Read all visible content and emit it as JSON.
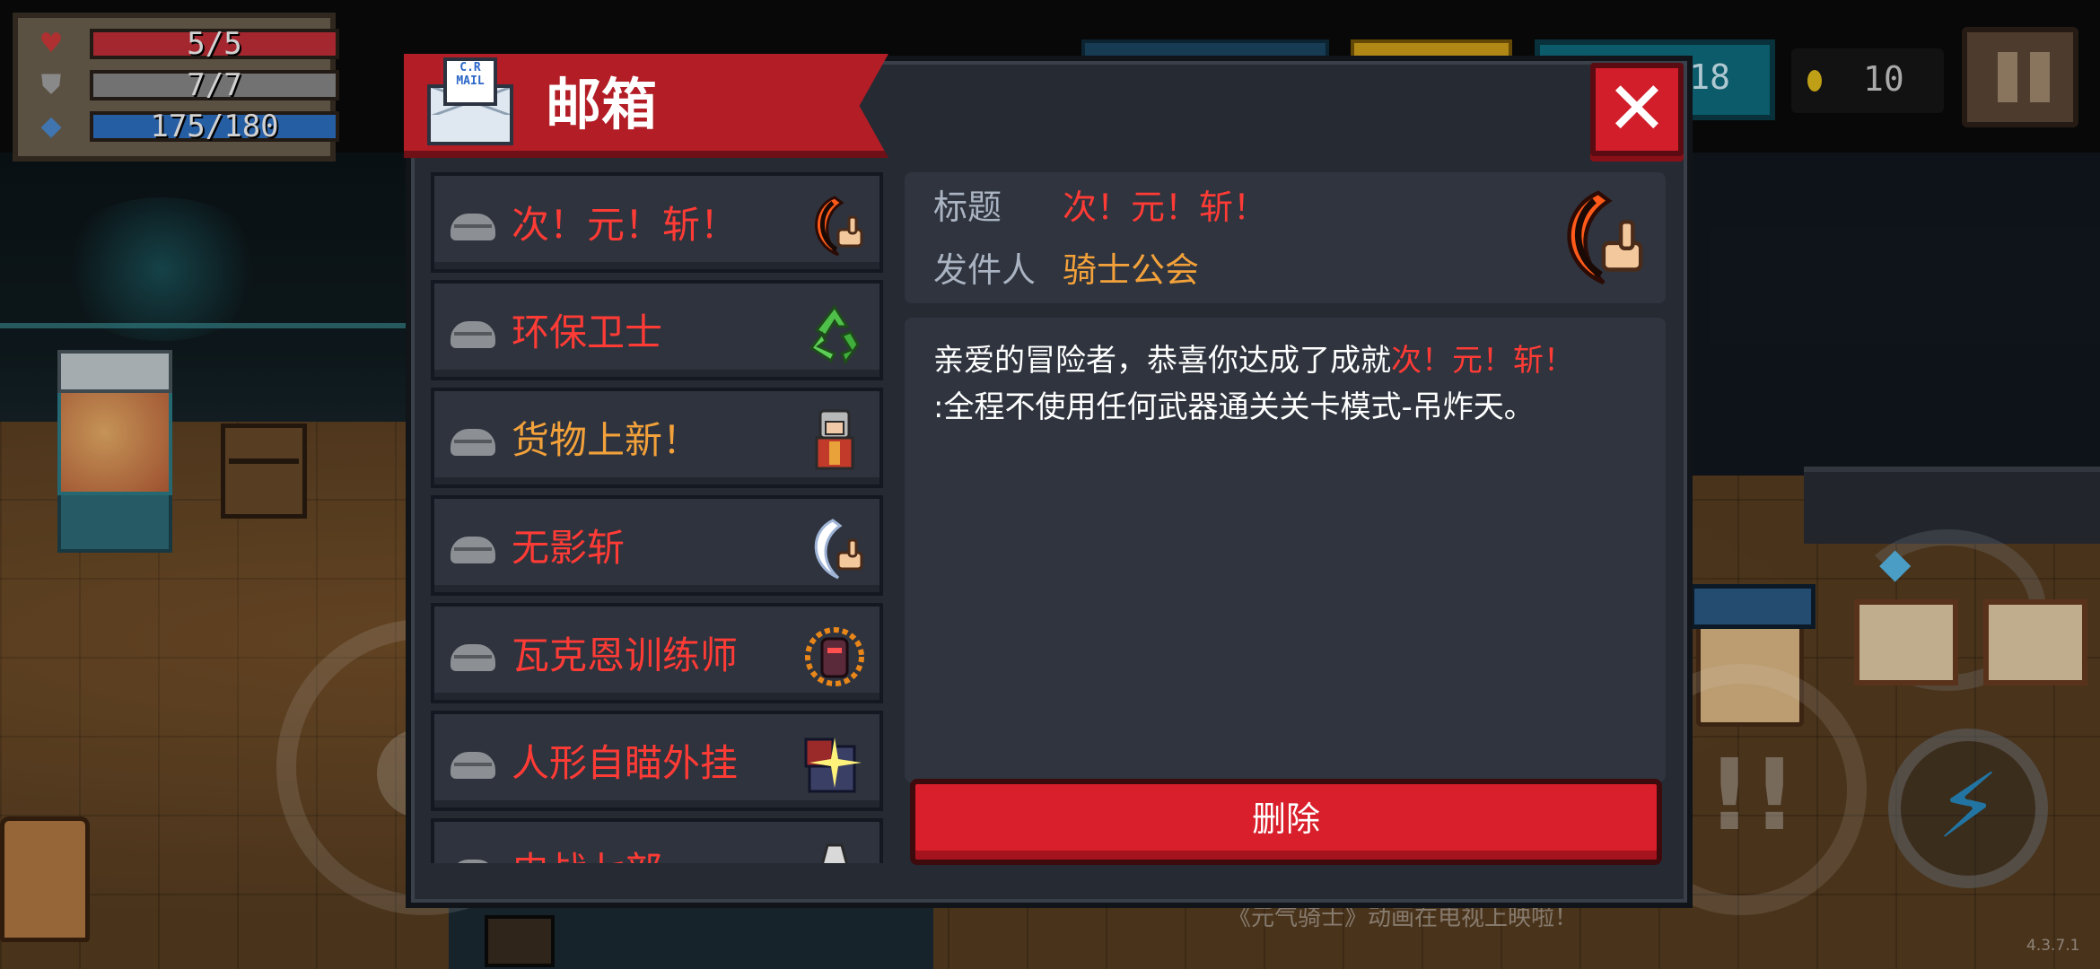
{
  "hud": {
    "hp": "5/5",
    "armor": "7/7",
    "energy": "175/180",
    "gems": "18",
    "coins": "10"
  },
  "mailbox": {
    "title": "邮箱",
    "mail_icon_text": [
      "C.R",
      "MAIL"
    ],
    "close_label": "✕",
    "items": [
      {
        "title": "次！元！斩！",
        "color": "#ff3b36",
        "icon": "crescent-slash-icon"
      },
      {
        "title": "环保卫士",
        "color": "#ff3b36",
        "icon": "recycle-icon"
      },
      {
        "title": "货物上新！",
        "color": "#f3a13a",
        "icon": "merchant-icon"
      },
      {
        "title": "无影斩",
        "color": "#ff3b36",
        "icon": "white-crescent-icon"
      },
      {
        "title": "瓦克恩训练师",
        "color": "#ff3b36",
        "icon": "trainer-icon"
      },
      {
        "title": "人形自瞄外挂",
        "color": "#ff3b36",
        "icon": "aimbot-icon"
      },
      {
        "title": "史战七部",
        "color": "#ff3b36",
        "icon": "cone-icon"
      }
    ],
    "detail": {
      "title_key": "标题",
      "title_value": "次！元！斩！",
      "sender_key": "发件人",
      "sender_value": "骑士公会",
      "body_prefix": "亲爱的冒险者，恭喜你达成了成就",
      "body_highlight": "次！元！斩！",
      "body_suffix": ":全程不使用任何武器通关关卡模式-吊炸天。",
      "delete_label": "删除"
    }
  },
  "background": {
    "ticker": "《元气骑士》动画在电视上映啦！",
    "version": "4.3.7.1"
  }
}
